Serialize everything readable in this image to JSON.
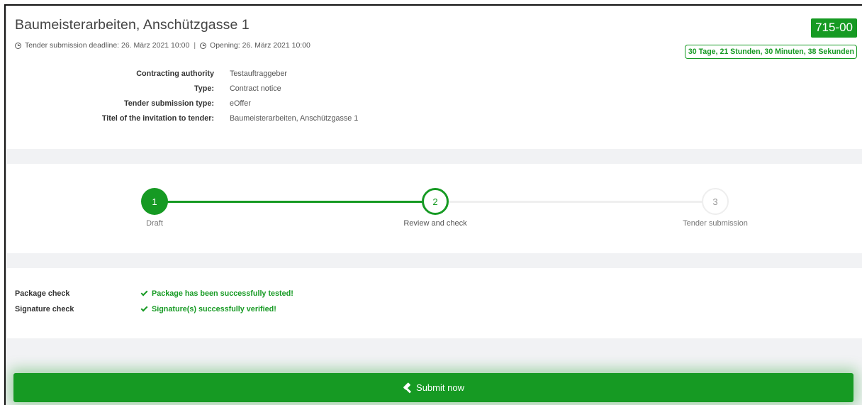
{
  "header": {
    "title": "Baumeisterarbeiten, Anschützgasse 1",
    "deadline": "Tender submission deadline: 26. März 2021 10:00",
    "separator": "|",
    "opening": "Opening: 26. März 2021 10:00",
    "tender_id": "715-00",
    "countdown": "30 Tage, 21 Stunden, 30 Minuten, 38 Sekunden"
  },
  "info": [
    {
      "label": "Contracting authority",
      "value": "Testauftraggeber"
    },
    {
      "label": "Type:",
      "value": "Contract notice"
    },
    {
      "label": "Tender submission type:",
      "value": "eOffer"
    },
    {
      "label": "Titel of the invitation to tender:",
      "value": "Baumeisterarbeiten, Anschützgasse 1"
    }
  ],
  "steps": [
    {
      "number": "1",
      "label": "Draft",
      "state": "done"
    },
    {
      "number": "2",
      "label": "Review and check",
      "state": "active"
    },
    {
      "number": "3",
      "label": "Tender submission",
      "state": "pending"
    }
  ],
  "checks": [
    {
      "label": "Package check",
      "status": "Package has been successfully tested!"
    },
    {
      "label": "Signature check",
      "status": "Signature(s) successfully verified!"
    }
  ],
  "submit": {
    "label": "Submit now",
    "icon": "gavel-icon"
  },
  "colors": {
    "accent": "#169a23",
    "background": "#f1f2f4"
  }
}
